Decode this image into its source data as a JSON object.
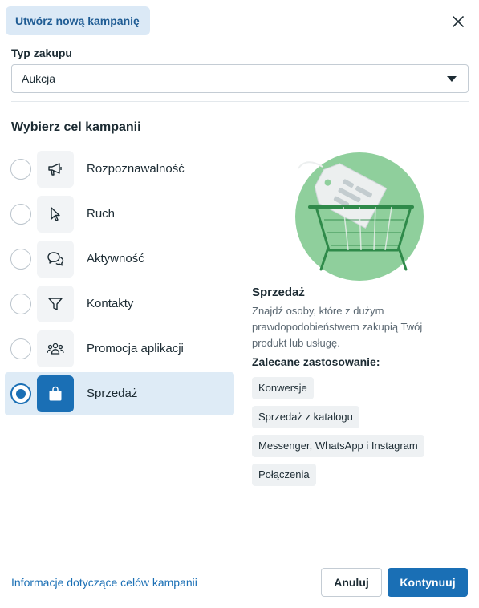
{
  "header": {
    "title": "Utwórz nową kampanię"
  },
  "purchase_type": {
    "label": "Typ zakupu",
    "value": "Aukcja"
  },
  "goal": {
    "heading": "Wybierz cel kampanii",
    "options": [
      {
        "label": "Rozpoznawalność",
        "icon": "megaphone-icon",
        "selected": false
      },
      {
        "label": "Ruch",
        "icon": "cursor-icon",
        "selected": false
      },
      {
        "label": "Aktywność",
        "icon": "chat-bubbles-icon",
        "selected": false
      },
      {
        "label": "Kontakty",
        "icon": "funnel-icon",
        "selected": false
      },
      {
        "label": "Promocja aplikacji",
        "icon": "people-icon",
        "selected": false
      },
      {
        "label": "Sprzedaż",
        "icon": "shopping-bag-icon",
        "selected": true
      }
    ]
  },
  "detail": {
    "title": "Sprzedaż",
    "description": "Znajdź osoby, które z dużym prawdopodobieństwem zakupią Twój produkt lub usługę.",
    "recommended_heading": "Zalecane zastosowanie:",
    "chips": [
      "Konwersje",
      "Sprzedaż z katalogu",
      "Messenger, WhatsApp i Instagram",
      "Połączenia"
    ]
  },
  "footer": {
    "info_link": "Informacje dotyczące celów kampanii",
    "cancel": "Anuluj",
    "continue": "Kontynuuj"
  },
  "colors": {
    "accent": "#1a6fb5",
    "selected_bg": "#deebf6",
    "tab_bg": "#dbe9f6",
    "illustration_green": "#8fcf9c",
    "illustration_dark_green": "#2f8a4a"
  }
}
